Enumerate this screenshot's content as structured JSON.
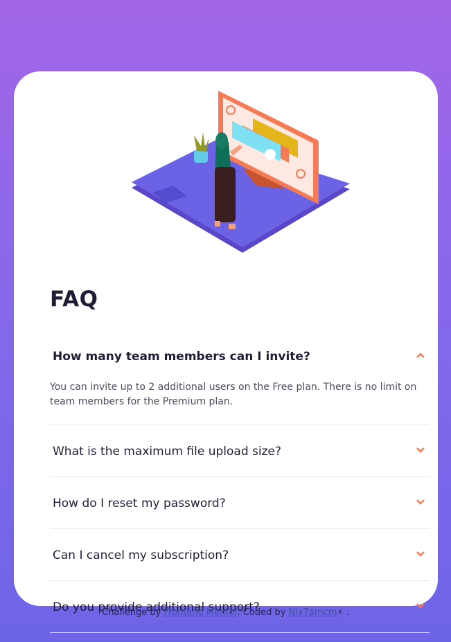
{
  "page": {
    "title": "FAQ"
  },
  "faq": [
    {
      "question": "How many team members can I invite?",
      "answer": "You can invite up to 2 additional users on the Free plan. There is no limit on team members for the Premium plan.",
      "expanded": true
    },
    {
      "question": "What is the maximum file upload size?",
      "expanded": false
    },
    {
      "question": "How do I reset my password?",
      "expanded": false
    },
    {
      "question": "Can I cancel my subscription?",
      "expanded": false
    },
    {
      "question": "Do you provide additional support?",
      "expanded": false
    }
  ],
  "footer": {
    "prefix": "Challenge by",
    "link1": "Frontend Mentor",
    "middle": ". Coded by",
    "link2": "Nix7amcm",
    "emoji": "⚡",
    "suffix": "."
  },
  "colors": {
    "accent": "#f47b56",
    "heading": "#1d1e35",
    "divider": "#e8e8ea"
  },
  "icons": {
    "expanded": "chevron-up-icon",
    "collapsed": "chevron-down-icon"
  }
}
